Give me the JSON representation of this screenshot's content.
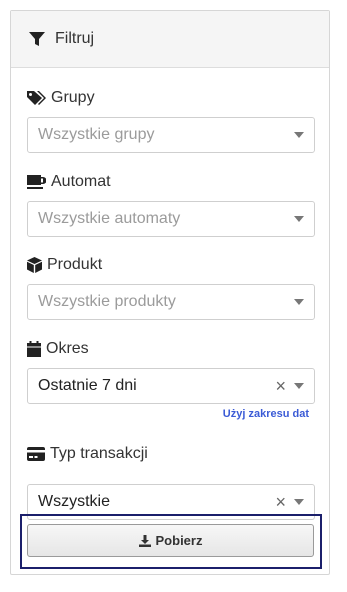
{
  "header": {
    "title": "Filtruj",
    "icon": "filter-icon"
  },
  "filters": {
    "groups": {
      "label": "Grupy",
      "icon": "tags-icon",
      "placeholder": "Wszystkie grupy"
    },
    "machine": {
      "label": "Automat",
      "icon": "coffee-icon",
      "placeholder": "Wszystkie automaty"
    },
    "product": {
      "label": "Produkt",
      "icon": "box-icon",
      "placeholder": "Wszystkie produkty"
    },
    "period": {
      "label": "Okres",
      "icon": "calendar-icon",
      "value": "Ostatnie 7 dni",
      "clear": "×",
      "link": "Użyj zakresu dat"
    },
    "transaction_type": {
      "label": "Typ transakcji",
      "icon": "credit-card-icon",
      "value": "Wszystkie",
      "clear": "×"
    }
  },
  "actions": {
    "download_label": "Pobierz",
    "download_icon": "download-icon"
  },
  "colors": {
    "link": "#3b5bd6",
    "highlight_border": "#1b1f6b"
  }
}
